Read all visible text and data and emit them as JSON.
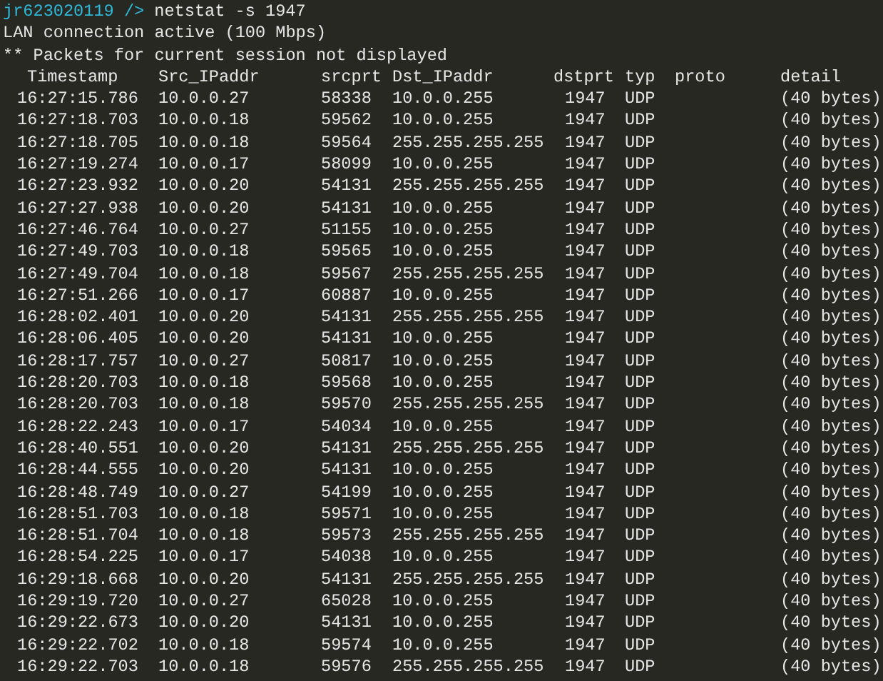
{
  "prompt": {
    "host": "jr623020119 />",
    "command": "netstat -s 1947"
  },
  "messages": [
    "LAN connection active (100 Mbps)",
    "** Packets for current session not displayed"
  ],
  "table": {
    "columns": [
      "Timestamp",
      "Src_IPaddr",
      "srcprt",
      "Dst_IPaddr",
      "dstprt",
      "typ",
      "proto",
      "detail"
    ],
    "rows": [
      [
        "16:27:15.786",
        "10.0.0.27",
        "58338",
        "10.0.0.255",
        "1947",
        "UDP",
        "(40 bytes)"
      ],
      [
        "16:27:18.703",
        "10.0.0.18",
        "59562",
        "10.0.0.255",
        "1947",
        "UDP",
        "(40 bytes)"
      ],
      [
        "16:27:18.705",
        "10.0.0.18",
        "59564",
        "255.255.255.255",
        "1947",
        "UDP",
        "(40 bytes)"
      ],
      [
        "16:27:19.274",
        "10.0.0.17",
        "58099",
        "10.0.0.255",
        "1947",
        "UDP",
        "(40 bytes)"
      ],
      [
        "16:27:23.932",
        "10.0.0.20",
        "54131",
        "255.255.255.255",
        "1947",
        "UDP",
        "(40 bytes)"
      ],
      [
        "16:27:27.938",
        "10.0.0.20",
        "54131",
        "10.0.0.255",
        "1947",
        "UDP",
        "(40 bytes)"
      ],
      [
        "16:27:46.764",
        "10.0.0.27",
        "51155",
        "10.0.0.255",
        "1947",
        "UDP",
        "(40 bytes)"
      ],
      [
        "16:27:49.703",
        "10.0.0.18",
        "59565",
        "10.0.0.255",
        "1947",
        "UDP",
        "(40 bytes)"
      ],
      [
        "16:27:49.704",
        "10.0.0.18",
        "59567",
        "255.255.255.255",
        "1947",
        "UDP",
        "(40 bytes)"
      ],
      [
        "16:27:51.266",
        "10.0.0.17",
        "60887",
        "10.0.0.255",
        "1947",
        "UDP",
        "(40 bytes)"
      ],
      [
        "16:28:02.401",
        "10.0.0.20",
        "54131",
        "255.255.255.255",
        "1947",
        "UDP",
        "(40 bytes)"
      ],
      [
        "16:28:06.405",
        "10.0.0.20",
        "54131",
        "10.0.0.255",
        "1947",
        "UDP",
        "(40 bytes)"
      ],
      [
        "16:28:17.757",
        "10.0.0.27",
        "50817",
        "10.0.0.255",
        "1947",
        "UDP",
        "(40 bytes)"
      ],
      [
        "16:28:20.703",
        "10.0.0.18",
        "59568",
        "10.0.0.255",
        "1947",
        "UDP",
        "(40 bytes)"
      ],
      [
        "16:28:20.703",
        "10.0.0.18",
        "59570",
        "255.255.255.255",
        "1947",
        "UDP",
        "(40 bytes)"
      ],
      [
        "16:28:22.243",
        "10.0.0.17",
        "54034",
        "10.0.0.255",
        "1947",
        "UDP",
        "(40 bytes)"
      ],
      [
        "16:28:40.551",
        "10.0.0.20",
        "54131",
        "255.255.255.255",
        "1947",
        "UDP",
        "(40 bytes)"
      ],
      [
        "16:28:44.555",
        "10.0.0.20",
        "54131",
        "10.0.0.255",
        "1947",
        "UDP",
        "(40 bytes)"
      ],
      [
        "16:28:48.749",
        "10.0.0.27",
        "54199",
        "10.0.0.255",
        "1947",
        "UDP",
        "(40 bytes)"
      ],
      [
        "16:28:51.703",
        "10.0.0.18",
        "59571",
        "10.0.0.255",
        "1947",
        "UDP",
        "(40 bytes)"
      ],
      [
        "16:28:51.704",
        "10.0.0.18",
        "59573",
        "255.255.255.255",
        "1947",
        "UDP",
        "(40 bytes)"
      ],
      [
        "16:28:54.225",
        "10.0.0.17",
        "54038",
        "10.0.0.255",
        "1947",
        "UDP",
        "(40 bytes)"
      ],
      [
        "16:29:18.668",
        "10.0.0.20",
        "54131",
        "255.255.255.255",
        "1947",
        "UDP",
        "(40 bytes)"
      ],
      [
        "16:29:19.720",
        "10.0.0.27",
        "65028",
        "10.0.0.255",
        "1947",
        "UDP",
        "(40 bytes)"
      ],
      [
        "16:29:22.673",
        "10.0.0.20",
        "54131",
        "10.0.0.255",
        "1947",
        "UDP",
        "(40 bytes)"
      ],
      [
        "16:29:22.702",
        "10.0.0.18",
        "59574",
        "10.0.0.255",
        "1947",
        "UDP",
        "(40 bytes)"
      ],
      [
        "16:29:22.703",
        "10.0.0.18",
        "59576",
        "255.255.255.255",
        "1947",
        "UDP",
        "(40 bytes)"
      ]
    ]
  }
}
